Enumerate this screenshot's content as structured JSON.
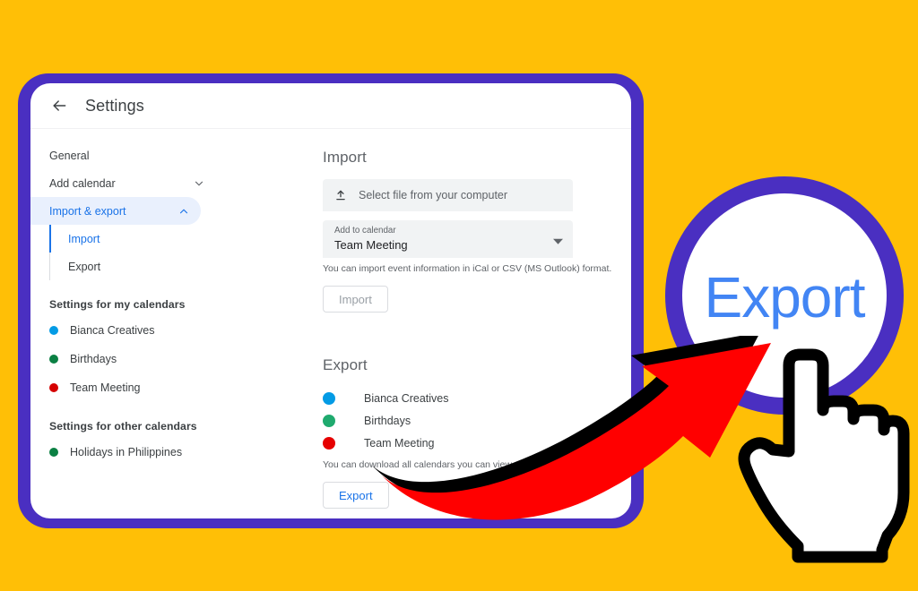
{
  "header": {
    "back_icon": "arrow-left-icon",
    "title": "Settings"
  },
  "sidebar": {
    "items": [
      {
        "label": "General",
        "icon": null,
        "active": false
      },
      {
        "label": "Add calendar",
        "icon": "chevron-down-icon",
        "active": false
      },
      {
        "label": "Import & export",
        "icon": "chevron-up-icon",
        "active": true
      }
    ],
    "sub_items": [
      {
        "label": "Import",
        "selected": true
      },
      {
        "label": "Export",
        "selected": false
      }
    ],
    "my_calendars_heading": "Settings for my calendars",
    "my_calendars": [
      {
        "label": "Bianca Creatives",
        "color": "#039be5"
      },
      {
        "label": "Birthdays",
        "color": "#0b8043"
      },
      {
        "label": "Team Meeting",
        "color": "#d50000"
      }
    ],
    "other_calendars_heading": "Settings for other calendars",
    "other_calendars": [
      {
        "label": "Holidays in Philippines",
        "color": "#0b8043"
      }
    ]
  },
  "import": {
    "section_title": "Import",
    "file_picker_label": "Select file from your computer",
    "file_picker_icon": "upload-icon",
    "add_to_calendar_label": "Add to calendar",
    "add_to_calendar_value": "Team Meeting",
    "dropdown_icon": "caret-down-icon",
    "helper_text": "You can import event information in iCal or CSV (MS Outlook) format.",
    "button_label": "Import",
    "button_disabled": true
  },
  "export": {
    "section_title": "Export",
    "calendars": [
      {
        "label": "Bianca Creatives",
        "color": "#039be5"
      },
      {
        "label": "Birthdays",
        "color": "#1faa6e"
      },
      {
        "label": "Team Meeting",
        "color": "#e60000"
      }
    ],
    "helper_text": "You can download all calendars you can view and modify.",
    "button_label": "Export"
  },
  "callout": {
    "text": "Export",
    "text_color": "#4285f4",
    "ring_color": "#4a2fc1",
    "arrow_color": "#ff0000",
    "arrow_shadow_color": "#000000",
    "cursor_icon": "pointing-hand-cursor"
  },
  "theme": {
    "background": "#ffbf06",
    "frame_border": "#4a2fc1",
    "accent_blue": "#1a73e8",
    "card_background": "#ffffff"
  }
}
